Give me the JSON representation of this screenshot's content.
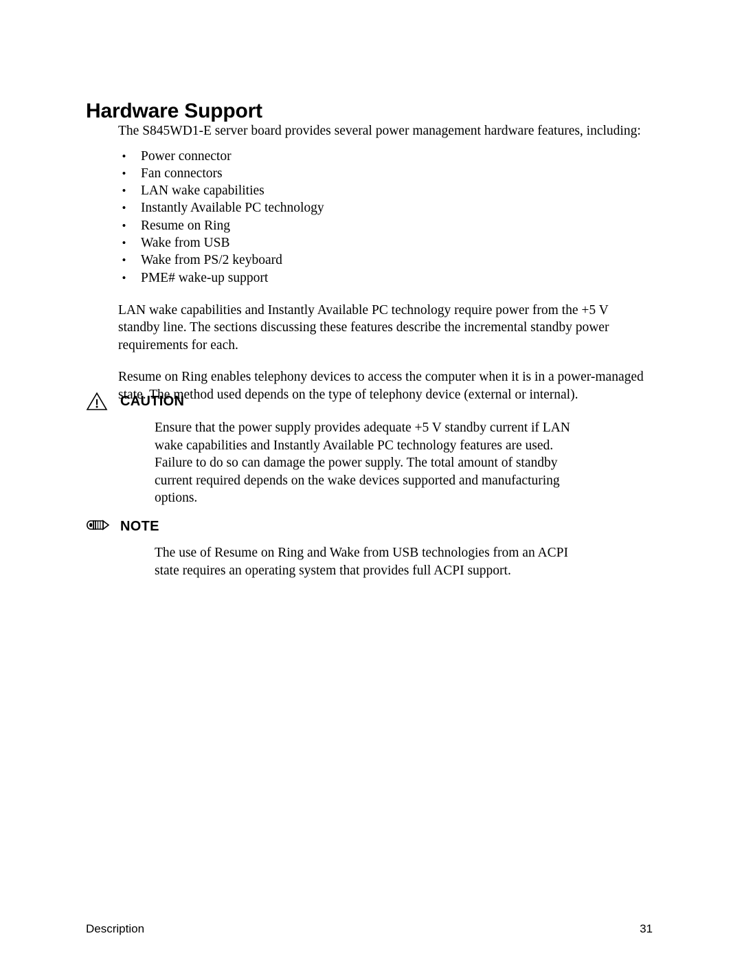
{
  "document": {
    "page_number": "31",
    "footer_left": "Description"
  },
  "heading": {
    "title": "Hardware Support"
  },
  "intro": {
    "paragraph": "The S845WD1-E server board provides several power management hardware features, including:"
  },
  "features": {
    "bullet_glyph": "•",
    "items": [
      "Power connector",
      "Fan connectors",
      "LAN wake capabilities",
      "Instantly Available PC technology",
      "Resume on Ring",
      "Wake from USB",
      "Wake from PS/2 keyboard",
      "PME# wake-up support"
    ]
  },
  "body": {
    "standby_paragraph": "LAN wake capabilities and Instantly Available PC technology require power from the +5 V standby line.  The sections discussing these features describe the incremental standby power requirements for each.",
    "resume_paragraph": "Resume on Ring enables telephony devices to access the computer when it is in a power-managed state.  The method used depends on the type of telephony device (external or internal)."
  },
  "caution": {
    "icon": "warning-triangle-icon",
    "label": "CAUTION",
    "text": "Ensure that the power supply provides adequate +5 V standby current if LAN wake capabilities and Instantly Available PC technology features are used.  Failure to do so can damage the power supply.  The total amount of standby current required depends on the wake devices supported and manufacturing options."
  },
  "note": {
    "icon": "pencil-icon",
    "label": "NOTE",
    "text": "The use of Resume on Ring and Wake from USB technologies from an ACPI state requires an operating system that provides full ACPI support."
  },
  "colors": {
    "text": "#000000",
    "background": "#ffffff"
  }
}
